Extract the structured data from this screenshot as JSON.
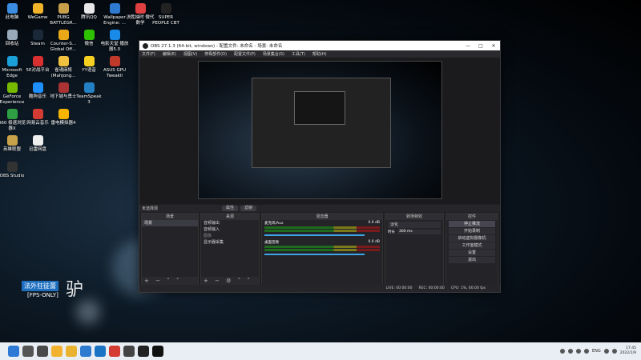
{
  "desktop": {
    "icons": [
      {
        "label": "此电脑",
        "color": "#3a8de0"
      },
      {
        "label": "WeGame",
        "color": "#f0b32a"
      },
      {
        "label": "PUBG BATTLEGR...",
        "color": "#c8a04a"
      },
      {
        "label": "腾讯QQ",
        "color": "#e8e8e8"
      },
      {
        "label": "Wallpaper Engine: ...",
        "color": "#2e7ad1"
      },
      {
        "label": "决胜抽时 微代数学",
        "color": "#e04040"
      },
      {
        "label": "SUPER PEOPLE CBT",
        "color": "#222"
      },
      {
        "label": "回收站",
        "color": "#9ab"
      },
      {
        "label": "Steam",
        "color": "#1b2838"
      },
      {
        "label": "Counter-S... Global Off...",
        "color": "#e8a818"
      },
      {
        "label": "微信",
        "color": "#2dc100"
      },
      {
        "label": "电影天堂 播放器5.0",
        "color": "#1a8ae8"
      },
      {
        "label": "Microsoft Edge",
        "color": "#1ba0d8"
      },
      {
        "label": "5E对战平台",
        "color": "#d83030"
      },
      {
        "label": "雀魂麻将 (Mahjong...",
        "color": "#f0c040"
      },
      {
        "label": "YY语音",
        "color": "#f5d020"
      },
      {
        "label": "ASUS GPU Tweakll",
        "color": "#c0392b"
      },
      {
        "label": "GeForce Experience",
        "color": "#76b900"
      },
      {
        "label": "酷狗音乐",
        "color": "#1e90ff"
      },
      {
        "label": "地下城与勇士",
        "color": "#a33"
      },
      {
        "label": "TeamSpeak 3",
        "color": "#2580c3"
      },
      {
        "label": "360 极速浏览器X",
        "color": "#2ea043"
      },
      {
        "label": "网易云音乐",
        "color": "#d43c33"
      },
      {
        "label": "雷电模拟器4",
        "color": "#f7b500"
      },
      {
        "label": "英雄联盟",
        "color": "#c8a24a"
      },
      {
        "label": "迅雷网盘",
        "color": "#eee"
      },
      {
        "label": "OBS Studio",
        "color": "#333"
      }
    ]
  },
  "obs": {
    "title": "OBS 27.1.3 (64-bit, windows) - 配置文件: 未命名 - 场景: 未命名",
    "window_buttons": [
      "—",
      "□",
      "✕"
    ],
    "menu": [
      "文件(F)",
      "编辑(E)",
      "视图(V)",
      "停靠部件(D)",
      "配置文件(P)",
      "场景集合(S)",
      "工具(T)",
      "帮助(H)"
    ],
    "scene_bar": {
      "label": "未选择源",
      "chip1": "属性",
      "chip2": "滤镜"
    },
    "scenes": {
      "header": "场景",
      "items": [
        "场景"
      ],
      "toolbar": "+ − ˄ ˅"
    },
    "sources": {
      "header": "来源",
      "items": [
        "音频输出",
        "音频输入",
        "图像",
        "显示器采集"
      ],
      "toolbar": "+ − ⚙ ˄ ˅"
    },
    "mixer": {
      "header": "混音器",
      "channels": [
        {
          "name": "麦克风/Aux",
          "db": "0.0 dB"
        },
        {
          "name": "桌面音频",
          "db": "0.0 dB"
        }
      ]
    },
    "transitions": {
      "header": "转场特效",
      "type": "淡化",
      "duration_label": "时长",
      "duration": "300 ms"
    },
    "controls": {
      "header": "控件",
      "buttons": [
        "停止推流",
        "开始录制",
        "启动虚拟摄像机",
        "工作室模式",
        "设置",
        "退出"
      ]
    },
    "status": {
      "live": "LIVE: 00:00:00",
      "rec": "REC: 00:00:00",
      "cpu": "CPU: 1%, 60.00 fps"
    }
  },
  "overlay": {
    "title": "法外狂徒蕾",
    "subtitle": "[FPS-ONLY]",
    "big": "驴"
  },
  "taskbar": {
    "icons": [
      {
        "color": "#2f79d6"
      },
      {
        "color": "#555"
      },
      {
        "color": "#4a4a4a"
      },
      {
        "color": "#f2b12f"
      },
      {
        "color": "#e9b22f"
      },
      {
        "color": "#2e7ad1"
      },
      {
        "color": "#1b73c4"
      },
      {
        "color": "#d43c33"
      },
      {
        "color": "#444"
      },
      {
        "color": "#222"
      },
      {
        "color": "#111"
      }
    ],
    "lang": "ENG",
    "time": "17:45",
    "date": "2022/1/9"
  }
}
